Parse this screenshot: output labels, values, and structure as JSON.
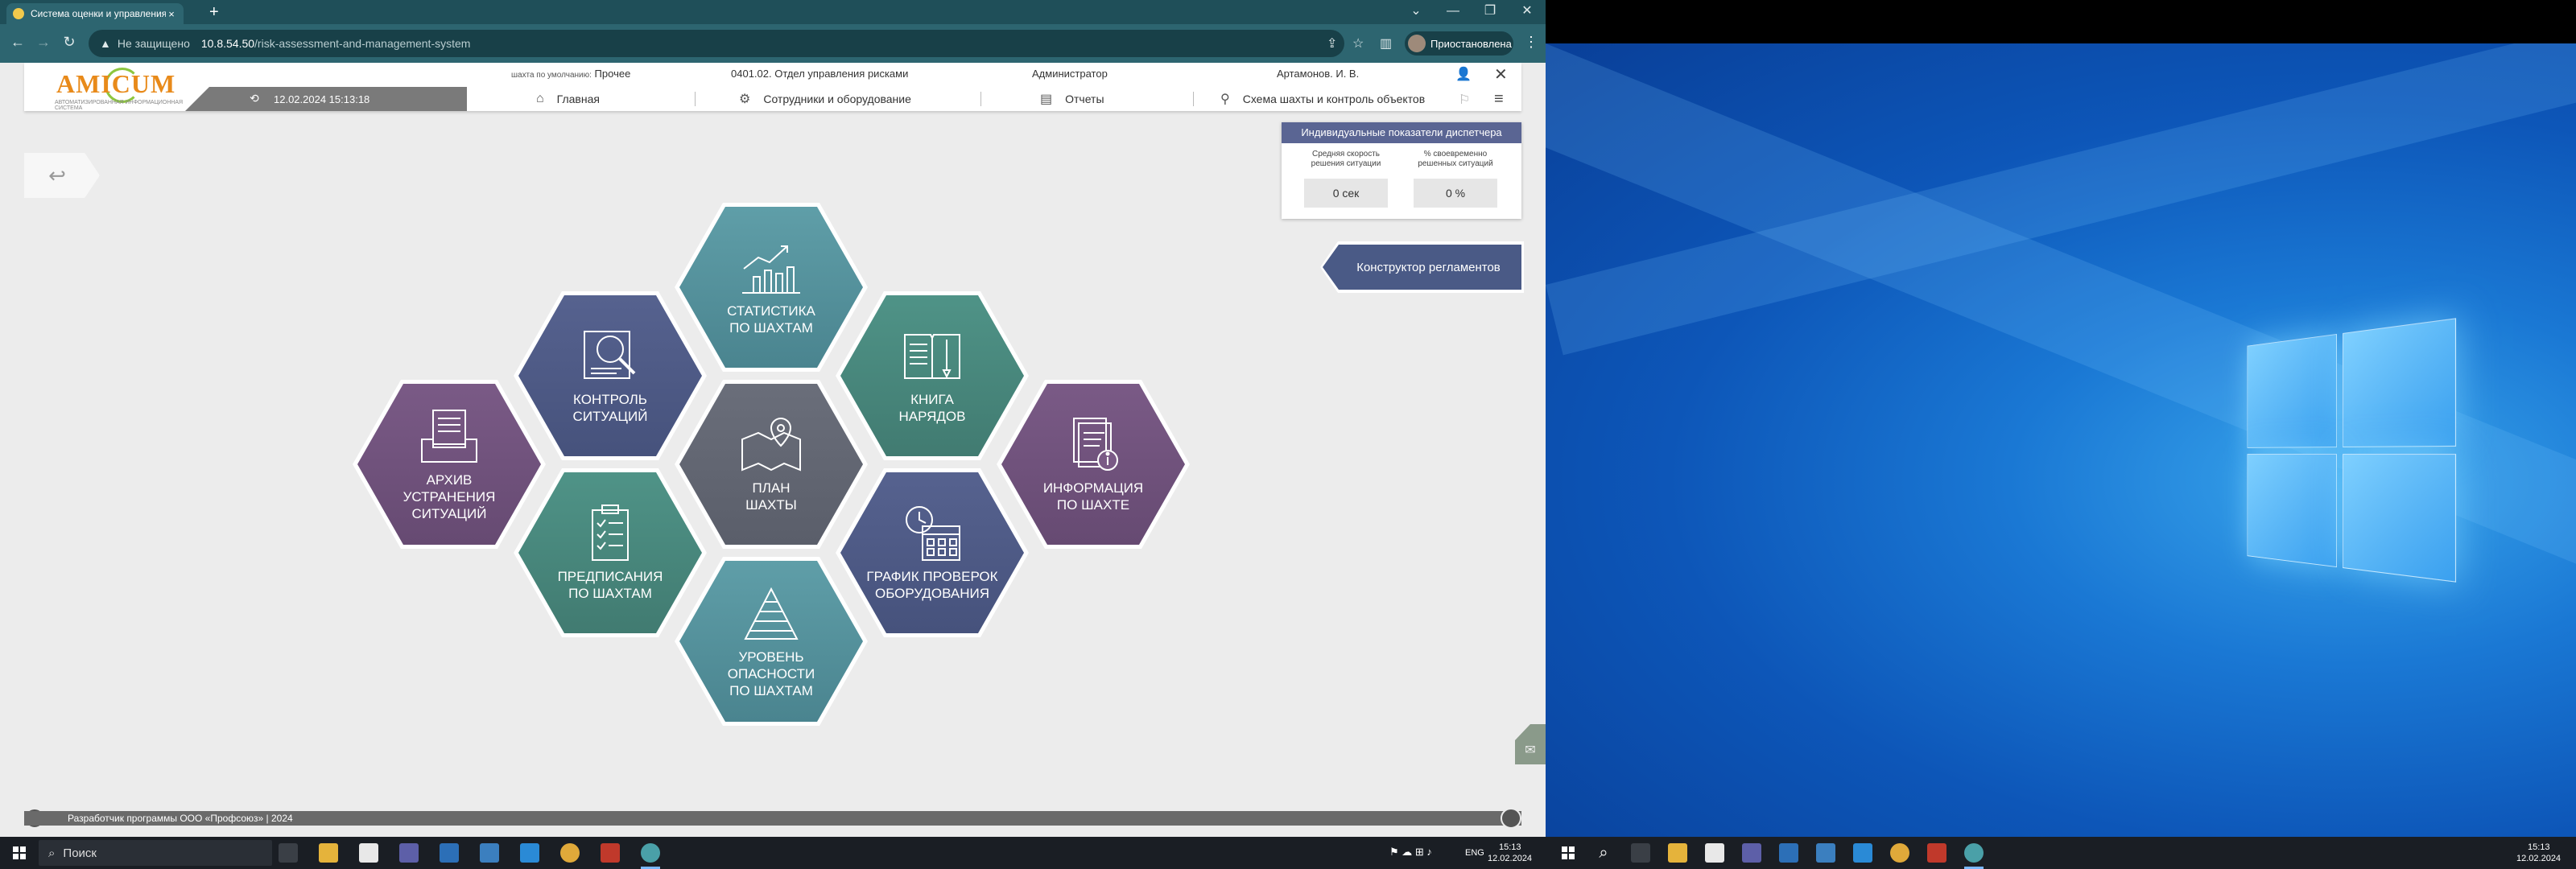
{
  "browser": {
    "tab_title": "Система оценки и управления",
    "tab_close": "×",
    "new_tab": "+",
    "security_label": "Не защищено",
    "url_host": "10.8.54.50",
    "url_path": "/risk-assessment-and-management-system",
    "profile_label": "Приостановлена",
    "window_controls": [
      "⌄",
      "—",
      "❐",
      "✕"
    ]
  },
  "header": {
    "logo_text_a": "AMI",
    "logo_text_b": "CUM",
    "logo_subtitle": "АВТОМАТИЗИРОВАННАЯ ИНФОРМАЦИОННАЯ СИСТЕМА",
    "mine_default_label": "шахта по умолчанию:",
    "mine_default_value": "Прочее",
    "department": "0401.02. Отдел управления рисками",
    "role": "Администратор",
    "user": "Артамонов. И. В.",
    "datetime": "12.02.2024 15:13:18"
  },
  "menu": [
    {
      "label": "Главная",
      "icon": "home-icon"
    },
    {
      "label": "Сотрудники и оборудование",
      "icon": "people-equipment-icon"
    },
    {
      "label": "Отчеты",
      "icon": "document-icon"
    },
    {
      "label": "Схема шахты и контроль объектов",
      "icon": "person-pin-icon"
    }
  ],
  "dispatcher": {
    "title": "Индивидуальные показатели диспетчера",
    "col1_label": "Средняя скорость решения ситуации",
    "col2_label": "% своевременно решенных ситуаций",
    "col1_value": "0 сек",
    "col2_value": "0 %"
  },
  "constructor_button": "Конструктор регламентов",
  "hexes": {
    "statistics": "СТАТИСТИКА\nПО ШАХТАМ",
    "control": "КОНТРОЛЬ\nСИТУАЦИЙ",
    "book": "КНИГА\nНАРЯДОВ",
    "archive": "АРХИВ\nУСТРАНЕНИЯ\nСИТУАЦИЙ",
    "plan": "ПЛАН\nШАХТЫ",
    "info": "ИНФОРМАЦИЯ\nПО ШАХТЕ",
    "orders": "ПРЕДПИСАНИЯ\nПО ШАХТАМ",
    "schedule": "ГРАФИК ПРОВЕРОК\nОБОРУДОВАНИЯ",
    "danger": "УРОВЕНЬ\nОПАСНОСТИ\nПО ШАХТАМ"
  },
  "footer": "Разработчик программы ООО «Профсоюз» | 2024",
  "taskbar_left": {
    "search_placeholder": "Поиск",
    "lang": "ENG",
    "time": "15:13",
    "date": "12.02.2024"
  },
  "taskbar_right": {
    "time": "15:13",
    "date": "12.02.2024"
  },
  "colors": {
    "teal": "#5f9ea8",
    "navy": "#56628f",
    "green": "#4f9387",
    "grey": "#6a6e7a",
    "plum": "#7a5a86",
    "browser_frame": "#2d6570"
  }
}
